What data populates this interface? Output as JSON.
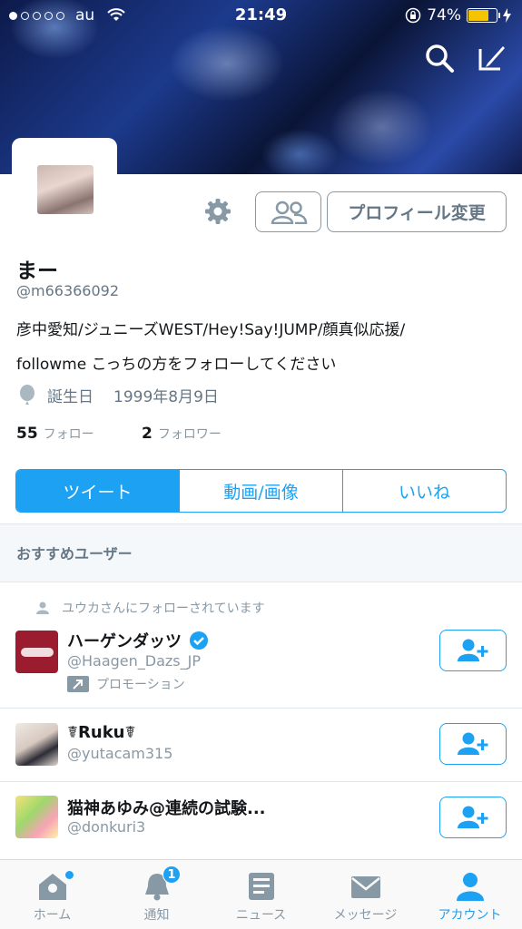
{
  "status_bar": {
    "carrier": "au",
    "time": "21:49",
    "battery": "74%"
  },
  "profile": {
    "name": "まー",
    "handle": "@m66366092",
    "bio_line1": "彦中愛知/ジュニーズWEST/Hey!Say!JUMP/顔真似応援/",
    "bio_line2": "followme こっちの方をフォローしてください",
    "birthday_label": "誕生日",
    "birthday_value": "1999年8月9日",
    "following_count": "55",
    "following_label": "フォロー",
    "followers_count": "2",
    "followers_label": "フォロワー",
    "edit_profile_label": "プロフィール変更"
  },
  "tabs": [
    {
      "label": "ツイート",
      "active": true
    },
    {
      "label": "動画/画像",
      "active": false
    },
    {
      "label": "いいね",
      "active": false
    }
  ],
  "recommended": {
    "header": "おすすめユーザー",
    "followed_by": "ユウカさんにフォローされています",
    "users": [
      {
        "name": "ハーゲンダッツ",
        "handle": "@Haagen_Dazs_JP",
        "verified": true,
        "promo": "プロモーション"
      },
      {
        "name": "☤Ruku☤",
        "handle": "@yutacam315"
      },
      {
        "name": "猫神あゆみ@連続の試験...",
        "handle": "@donkuri3"
      }
    ]
  },
  "tabbar": {
    "items": [
      {
        "label": "ホーム",
        "icon": "home-icon"
      },
      {
        "label": "通知",
        "icon": "bell-icon",
        "badge": "1"
      },
      {
        "label": "ニュース",
        "icon": "news-icon"
      },
      {
        "label": "メッセージ",
        "icon": "envelope-icon"
      },
      {
        "label": "アカウント",
        "icon": "person-icon",
        "active": true
      }
    ]
  },
  "colors": {
    "accent": "#1da1f2",
    "muted": "#8899a6",
    "text": "#14171a"
  }
}
